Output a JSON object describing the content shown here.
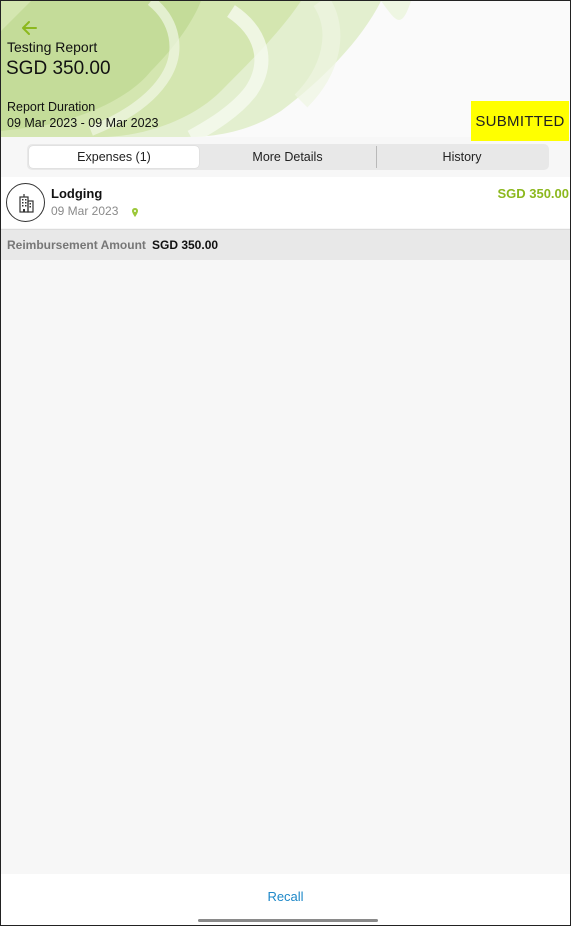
{
  "header": {
    "report_name": "Testing Report",
    "report_amount": "SGD 350.00",
    "duration_label": "Report Duration",
    "duration_value": "09 Mar 2023 - 09 Mar 2023",
    "status": "SUBMITTED"
  },
  "tabs": [
    {
      "label": "Expenses (1)",
      "active": true
    },
    {
      "label": "More Details",
      "active": false
    },
    {
      "label": "History",
      "active": false
    }
  ],
  "expenses": [
    {
      "title": "Lodging",
      "date": "09 Mar 2023",
      "amount": "SGD 350.00",
      "icon": "building-icon"
    }
  ],
  "reimbursement": {
    "label": "Reimbursement Amount",
    "value": "SGD 350.00"
  },
  "footer": {
    "recall_label": "Recall"
  },
  "colors": {
    "accent_green": "#8cb81e",
    "status_yellow": "#ffff00",
    "link_blue": "#1e88c8"
  }
}
